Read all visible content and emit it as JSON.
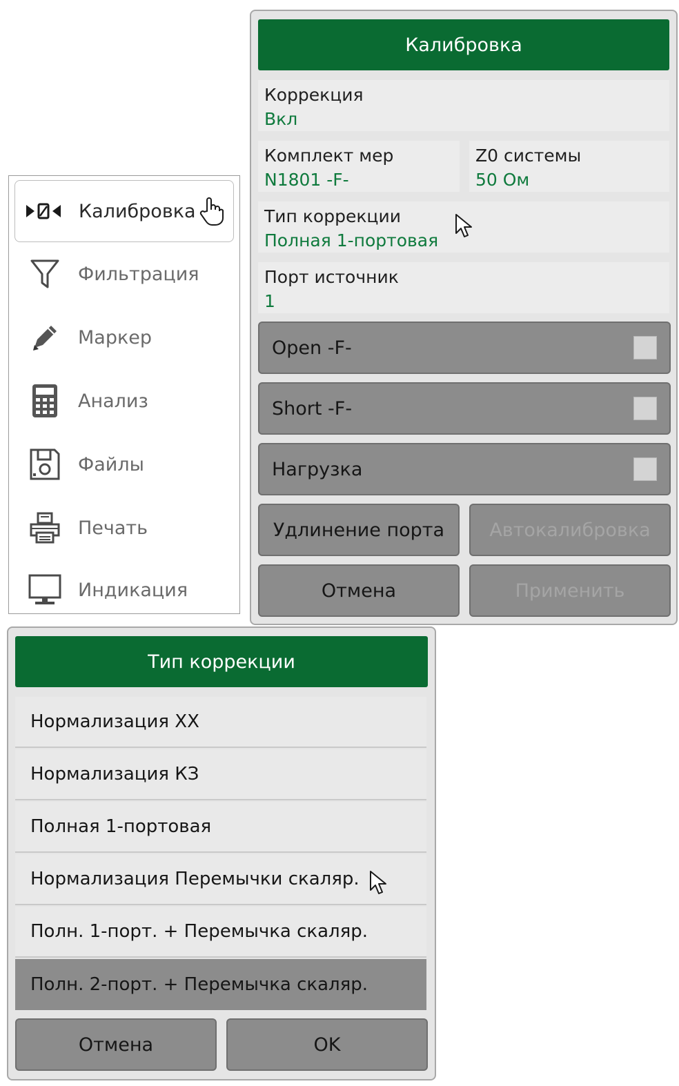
{
  "menu": {
    "items": [
      {
        "label": "Калибровка",
        "icon": "calibration-icon",
        "active": true
      },
      {
        "label": "Фильтрация",
        "icon": "filter-icon"
      },
      {
        "label": "Маркер",
        "icon": "pencil-icon"
      },
      {
        "label": "Анализ",
        "icon": "calculator-icon"
      },
      {
        "label": "Файлы",
        "icon": "floppy-disk-icon"
      },
      {
        "label": "Печать",
        "icon": "printer-icon"
      },
      {
        "label": "Индикация",
        "icon": "monitor-icon"
      }
    ]
  },
  "calibration": {
    "title": "Калибровка",
    "correction": {
      "label": "Коррекция",
      "value": "Вкл"
    },
    "kit": {
      "label": "Комплект мер",
      "value": "N1801 -F-"
    },
    "z0": {
      "label": "Z0 системы",
      "value": "50 Ом"
    },
    "correction_type": {
      "label": "Тип коррекции",
      "value": "Полная 1-портовая"
    },
    "source_port": {
      "label": "Порт источник",
      "value": "1"
    },
    "standards": [
      {
        "label": "Open -F-",
        "checked": false
      },
      {
        "label": "Short -F-",
        "checked": false
      },
      {
        "label": "Нагрузка",
        "checked": false
      }
    ],
    "port_extension_label": "Удлинение порта",
    "autocal_label": "Автокалибровка",
    "cancel_label": "Отмена",
    "apply_label": "Применить"
  },
  "correction_type_menu": {
    "title": "Тип коррекции",
    "options": [
      "Нормализация ХХ",
      "Нормализация КЗ",
      "Полная 1-портовая",
      "Нормализация Перемычки скаляр.",
      "Полн. 1-порт. + Перемычка скаляр.",
      "Полн. 2-порт. + Перемычка скаляр."
    ],
    "selected_index": 5,
    "cancel_label": "Отмена",
    "ok_label": "OK"
  },
  "colors": {
    "accent_green": "#0a6b32",
    "value_green": "#0f7a3d",
    "button_gray": "#8c8c8c"
  }
}
